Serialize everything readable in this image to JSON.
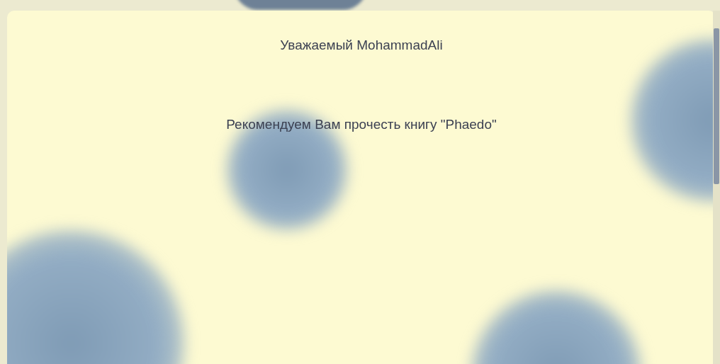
{
  "greeting": "Уважаемый MohammadAli",
  "recommendation": "Рекомендуем Вам прочесть книгу \"Phaedo\""
}
